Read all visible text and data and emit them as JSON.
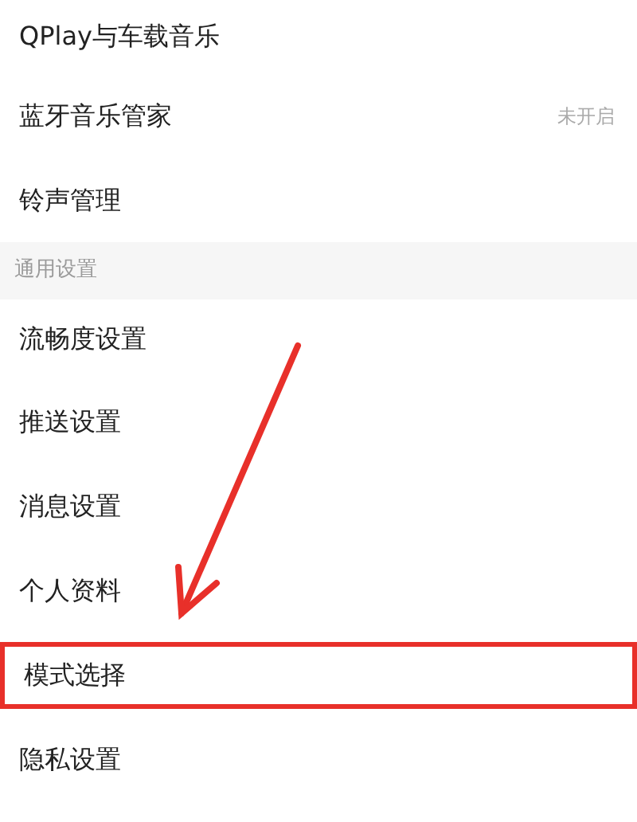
{
  "items": [
    {
      "kind": "row",
      "label": "QPlay与车载音乐",
      "highlighted": false
    },
    {
      "kind": "row",
      "label": "蓝牙音乐管家",
      "value": "未开启",
      "highlighted": false
    },
    {
      "kind": "row",
      "label": "铃声管理",
      "highlighted": false
    },
    {
      "kind": "header",
      "label": "通用设置"
    },
    {
      "kind": "row",
      "label": "流畅度设置",
      "highlighted": false
    },
    {
      "kind": "row",
      "label": "推送设置",
      "highlighted": false
    },
    {
      "kind": "row",
      "label": "消息设置",
      "highlighted": false
    },
    {
      "kind": "row",
      "label": "个人资料",
      "highlighted": false
    },
    {
      "kind": "row",
      "label": "模式选择",
      "highlighted": true
    },
    {
      "kind": "row",
      "label": "隐私设置",
      "highlighted": false
    }
  ]
}
